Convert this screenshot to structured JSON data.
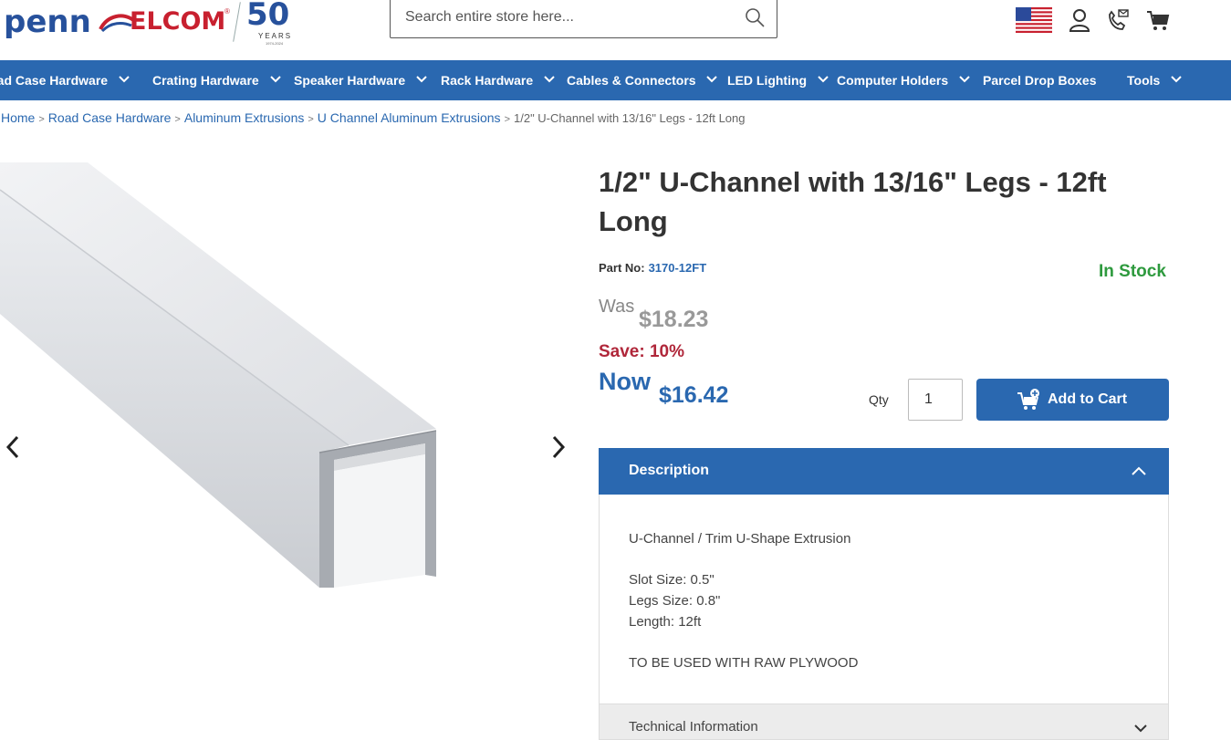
{
  "brand": {
    "name_left": "penn",
    "name_right": "ELCOM",
    "reg": "®",
    "anniversary": "50",
    "years": "YEARS",
    "span": "1974-2024"
  },
  "search": {
    "placeholder": "Search entire store here..."
  },
  "header_icons": [
    "us-flag-icon",
    "user-icon",
    "phone-mail-icon",
    "cart-icon"
  ],
  "nav": {
    "items": [
      {
        "label": "Road Case Hardware",
        "dropdown": true
      },
      {
        "label": "Crating Hardware",
        "dropdown": true
      },
      {
        "label": "Speaker Hardware",
        "dropdown": true
      },
      {
        "label": "Rack Hardware",
        "dropdown": true
      },
      {
        "label": "Cables & Connectors",
        "dropdown": true
      },
      {
        "label": "LED Lighting",
        "dropdown": true
      },
      {
        "label": "Computer Holders",
        "dropdown": true
      },
      {
        "label": "Parcel Drop Boxes",
        "dropdown": false
      },
      {
        "label": "Tools",
        "dropdown": true
      }
    ]
  },
  "breadcrumb": {
    "links": [
      "Home",
      "Road Case Hardware",
      "Aluminum Extrusions",
      "U Channel Aluminum Extrusions"
    ],
    "current": "1/2\" U-Channel with 13/16\" Legs - 12ft Long",
    "separator": ">"
  },
  "product": {
    "title": "1/2\" U-Channel with 13/16\" Legs - 12ft Long",
    "part_label": "Part No:",
    "part_no": "3170-12FT",
    "stock": "In Stock",
    "was_label": "Was",
    "was_price": "$18.23",
    "save": "Save: 10%",
    "now_label": "Now",
    "now_price": "$16.42",
    "qty_label": "Qty",
    "qty_value": "1",
    "add_to_cart": "Add to Cart"
  },
  "description": {
    "heading": "Description",
    "line1": "U-Channel / Trim U-Shape Extrusion",
    "slot": "Slot Size: 0.5\"",
    "legs": "Legs Size: 0.8\"",
    "length": "Length: 12ft",
    "note": "TO BE USED WITH RAW PLYWOOD"
  },
  "technical": {
    "heading": "Technical Information"
  },
  "colors": {
    "brand_blue": "#2a68b0",
    "brand_red": "#c8202f",
    "stock_green": "#2e9a3e",
    "save_red": "#b0273a"
  }
}
